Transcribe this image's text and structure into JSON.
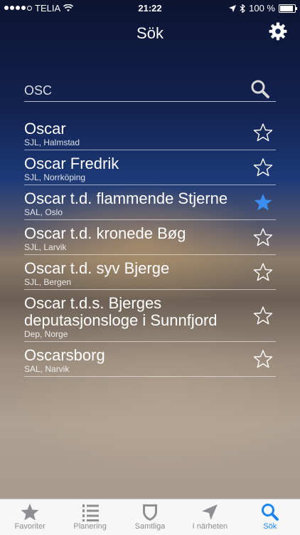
{
  "status": {
    "carrier": "TELIA",
    "time": "21:22",
    "battery": "100 %"
  },
  "header": {
    "title": "Sök"
  },
  "search": {
    "value": "OSC",
    "placeholder": ""
  },
  "results": [
    {
      "name": "Oscar",
      "sub": "SJL, Halmstad",
      "favorite": false
    },
    {
      "name": "Oscar Fredrik",
      "sub": "SJL, Norrköping",
      "favorite": false
    },
    {
      "name": "Oscar t.d. flammende Stjerne",
      "sub": "SAL, Oslo",
      "favorite": true
    },
    {
      "name": "Oscar t.d. kronede Bøg",
      "sub": "SJL, Larvik",
      "favorite": false
    },
    {
      "name": "Oscar t.d. syv Bjerge",
      "sub": "SJL, Bergen",
      "favorite": false
    },
    {
      "name": "Oscar t.d.s. Bjerges deputasjonsloge i Sunnfjord",
      "sub": "Dep, Norge",
      "favorite": false
    },
    {
      "name": "Oscarsborg",
      "sub": "SAL, Narvik",
      "favorite": false
    }
  ],
  "tabbar": {
    "tabs": [
      {
        "label": "Favoriter",
        "icon": "star-icon"
      },
      {
        "label": "Planering",
        "icon": "list-icon"
      },
      {
        "label": "Samtliga",
        "icon": "shield-icon"
      },
      {
        "label": "I närheten",
        "icon": "location-arrow-icon"
      },
      {
        "label": "Sök",
        "icon": "search-icon"
      }
    ],
    "active": "Sök"
  },
  "colors": {
    "accent": "#1c84f0",
    "favorite_star": "#3b8ef0",
    "tab_inactive": "#8e8e93"
  }
}
